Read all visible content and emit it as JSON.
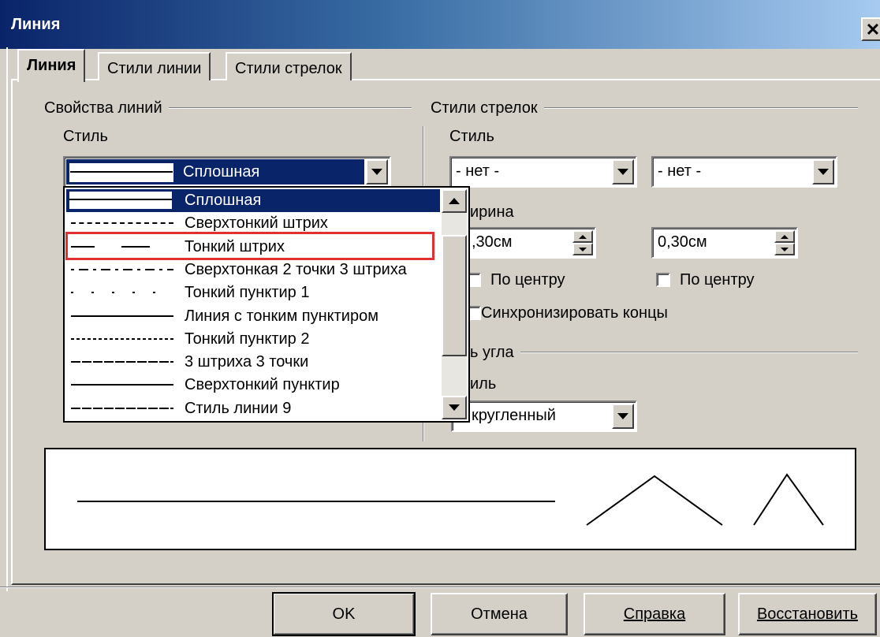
{
  "window": {
    "title": "Линия"
  },
  "tabs": [
    {
      "label": "Линия"
    },
    {
      "label": "Стили линии"
    },
    {
      "label": "Стили стрелок"
    }
  ],
  "line_props": {
    "group_title": "Свойства линий",
    "style_label": "Стиль",
    "style_value": "Сплошная",
    "dropdown_items": [
      {
        "label": "Сплошная",
        "selected": true,
        "pattern": "solid"
      },
      {
        "label": "Сверхтонкий штрих",
        "pattern": "fine-dash"
      },
      {
        "label": "Тонкий штрих",
        "pattern": "long-dash",
        "highlighted": true
      },
      {
        "label": "Сверхтонкая 2 точки 3 штриха",
        "pattern": "dot-dash"
      },
      {
        "label": "Тонкий пунктир 1",
        "pattern": "sparse-dot"
      },
      {
        "label": "Линия с тонким пунктиром",
        "pattern": "solid-thin"
      },
      {
        "label": "Тонкий пунктир 2",
        "pattern": "dense-dash"
      },
      {
        "label": "3 штриха 3 точки",
        "pattern": "medium-dash"
      },
      {
        "label": "Сверхтонкий пунктир",
        "pattern": "solid-thin"
      },
      {
        "label": "Стиль линии 9",
        "pattern": "medium-dash"
      }
    ]
  },
  "arrow_styles": {
    "group_title": "Стили стрелок",
    "style_label": "Стиль",
    "start_value": "- нет -",
    "end_value": "- нет -",
    "width_label": "ирина",
    "start_width": ",30см",
    "end_width": "0,30см",
    "center_label_left": "По центру",
    "center_label_right": "По центру",
    "sync_label": "Синхронизировать концы"
  },
  "corner": {
    "group_title": "ь угла",
    "style_label": "иль",
    "value": "кругленный"
  },
  "buttons": {
    "ok": "OK",
    "cancel": "Отмена",
    "help": "Справка",
    "reset": "Восстановить"
  },
  "colors": {
    "selection": "#0a246a",
    "highlight_border": "#e03030",
    "face": "#d4d0c8"
  }
}
